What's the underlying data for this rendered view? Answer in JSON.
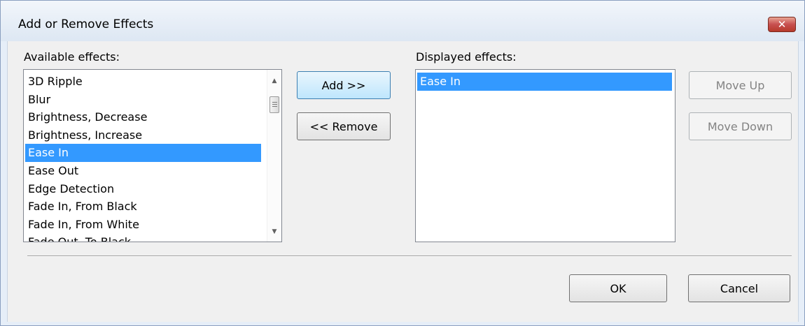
{
  "window": {
    "title": "Add or Remove Effects",
    "close_symbol": "✕"
  },
  "available": {
    "label": "Available effects:",
    "items": [
      "3D Ripple",
      "Blur",
      "Brightness, Decrease",
      "Brightness, Increase",
      "Ease In",
      "Ease Out",
      "Edge Detection",
      "Fade In, From Black",
      "Fade In, From White",
      "Fade Out, To Black"
    ],
    "selected": "Ease In"
  },
  "displayed": {
    "label": "Displayed effects:",
    "items": [
      "Ease In"
    ],
    "selected": "Ease In"
  },
  "buttons": {
    "add": "Add >>",
    "remove": "<< Remove",
    "move_up": "Move Up",
    "move_down": "Move Down",
    "ok": "OK",
    "cancel": "Cancel"
  },
  "icons": {
    "close": "close-icon",
    "scroll_up": "scroll-up-arrow-icon",
    "scroll_down": "scroll-down-arrow-icon"
  },
  "colors": {
    "selection": "#3399ff",
    "close_button": "#c75050"
  }
}
